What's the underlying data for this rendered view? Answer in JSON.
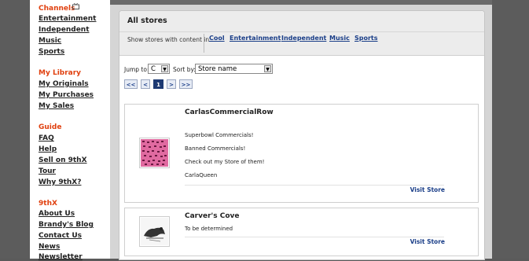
{
  "sidebar": {
    "channels": {
      "title": "Channels",
      "items": [
        "Entertainment",
        "Independent",
        "Music",
        "Sports"
      ]
    },
    "library": {
      "title": "My Library",
      "items": [
        "My Originals",
        "My Purchases",
        "My Sales"
      ]
    },
    "guide": {
      "title": "Guide",
      "items": [
        "FAQ",
        "Help",
        "Sell on 9thX",
        "Tour",
        "Why 9thX?"
      ]
    },
    "ninthx": {
      "title": "9thX",
      "items": [
        "About Us",
        "Brandy's Blog",
        "Contact Us",
        "News",
        "Newsletter"
      ]
    }
  },
  "panel": {
    "title": "All stores",
    "filter_label": "Show stores with content in:",
    "filters": [
      "Cool",
      "Entertainment",
      "Independent",
      "Music",
      "Sports"
    ]
  },
  "controls": {
    "jump_label": "Jump to:",
    "jump_value": "C",
    "sort_label": "Sort by:",
    "sort_value": "Store name"
  },
  "pager": {
    "first": "<<",
    "prev": "<",
    "current": "1",
    "next": ">",
    "last": ">>"
  },
  "stores": [
    {
      "name": "CarlasCommercialRow",
      "lines": [
        "Superbowl Commercials!",
        "Banned Commercials!",
        "Check out my Store of them!",
        "CarlaQueen"
      ],
      "visit": "Visit Store"
    },
    {
      "name": "Carver's Cove",
      "lines": [
        "To be determined"
      ],
      "visit": "Visit Store"
    }
  ],
  "colors": {
    "accent_orange": "#e0400f",
    "link_blue": "#1a3e88",
    "pager_active": "#1d3a73"
  }
}
